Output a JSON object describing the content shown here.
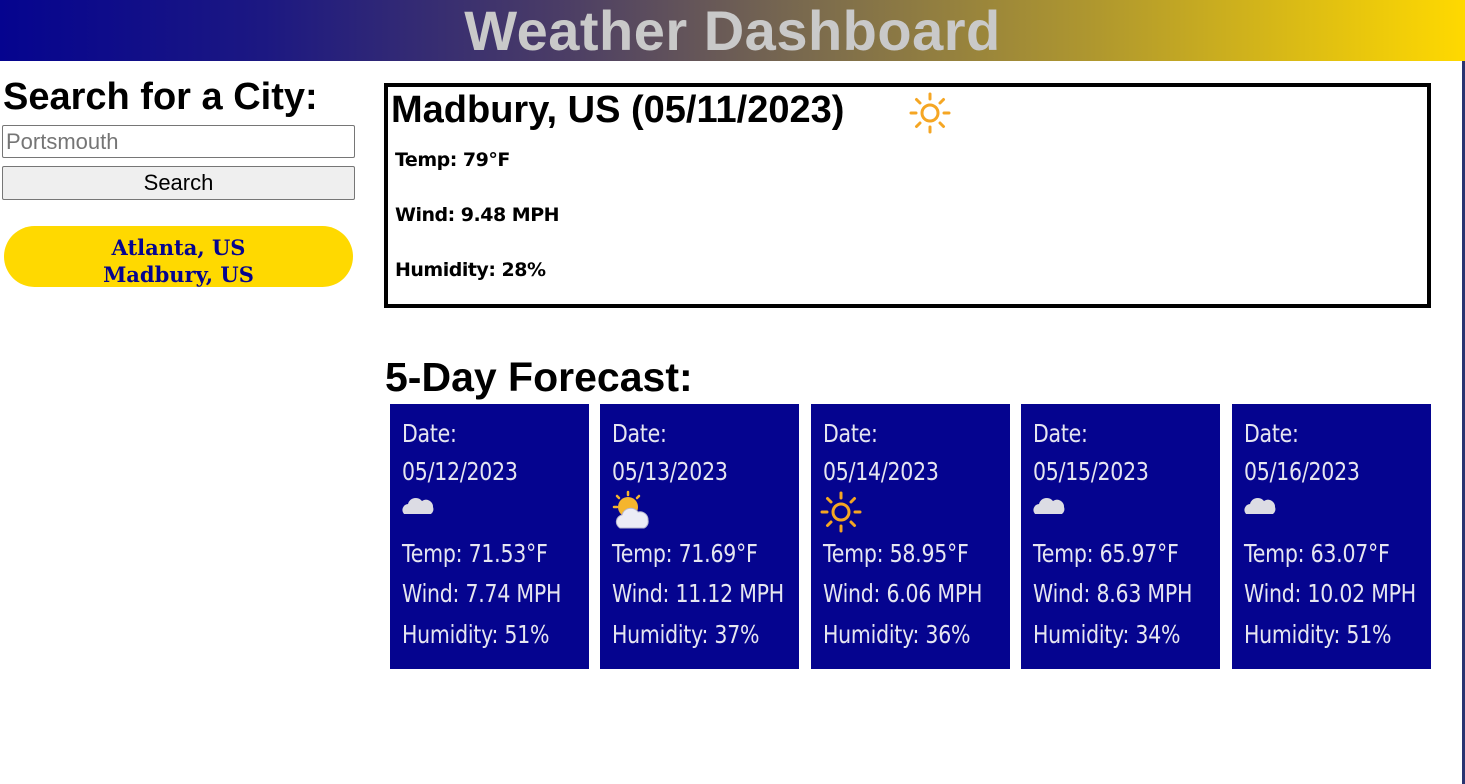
{
  "header": {
    "title": "Weather Dashboard"
  },
  "sidebar": {
    "heading": "Search for a City:",
    "search_placeholder": "Portsmouth",
    "search_value": "",
    "search_button_label": "Search",
    "history": [
      "Atlanta, US",
      "Madbury, US"
    ]
  },
  "current": {
    "title": "Madbury, US (05/11/2023)",
    "icon": "sun-icon",
    "temp": "Temp: 79°F",
    "wind": "Wind: 9.48 MPH",
    "humidity": "Humidity: 28%"
  },
  "forecast": {
    "heading": "5-Day Forecast:",
    "days": [
      {
        "date_label": "Date:",
        "date": "05/12/2023",
        "icon": "cloud-icon",
        "temp": "Temp: 71.53°F",
        "wind": "Wind: 7.74 MPH",
        "humidity": "Humidity: 51%"
      },
      {
        "date_label": "Date:",
        "date": "05/13/2023",
        "icon": "sun-behind-cloud-icon",
        "temp": "Temp: 71.69°F",
        "wind": "Wind: 11.12 MPH",
        "humidity": "Humidity: 37%"
      },
      {
        "date_label": "Date:",
        "date": "05/14/2023",
        "icon": "sun-icon",
        "temp": "Temp: 58.95°F",
        "wind": "Wind: 6.06 MPH",
        "humidity": "Humidity: 36%"
      },
      {
        "date_label": "Date:",
        "date": "05/15/2023",
        "icon": "cloud-icon",
        "temp": "Temp: 65.97°F",
        "wind": "Wind: 8.63 MPH",
        "humidity": "Humidity: 34%"
      },
      {
        "date_label": "Date:",
        "date": "05/16/2023",
        "icon": "cloud-icon",
        "temp": "Temp: 63.07°F",
        "wind": "Wind: 10.02 MPH",
        "humidity": "Humidity: 51%"
      }
    ]
  },
  "colors": {
    "header_start": "#05048f",
    "header_end": "#ffd900",
    "accent_yellow": "#ffd900",
    "card_blue": "#05048f",
    "sun_orange": "#f5a623"
  }
}
